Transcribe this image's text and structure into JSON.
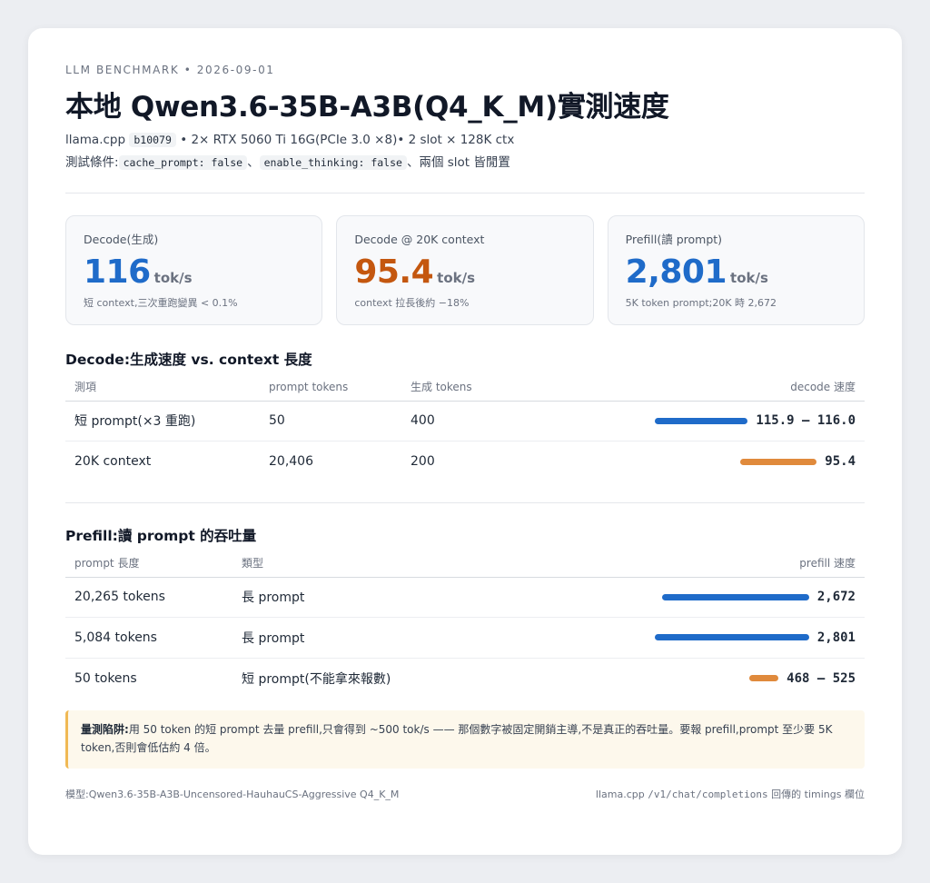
{
  "header": {
    "eyebrow": "LLM BENCHMARK • 2026-09-01",
    "title": "本地 Qwen3.6-35B-A3B(Q4_K_M)實測速度",
    "sub1": {
      "prefix": "llama.cpp",
      "build": "b10079",
      "rest": "• 2× RTX 5060 Ti 16G(PCIe 3.0 ×8)• 2 slot × 128K ctx"
    },
    "sub2": {
      "prefix": "測試條件:",
      "code1": "cache_prompt: false",
      "sep": "、",
      "code2": "enable_thinking: false",
      "suffix": "、兩個 slot 皆閒置"
    }
  },
  "stats": [
    {
      "label": "Decode(生成)",
      "value": "116",
      "unit": "tok/s",
      "note": "短 context,三次重跑變異 < 0.1%",
      "color": "#1f6bc9"
    },
    {
      "label": "Decode @ 20K context",
      "value": "95.4",
      "unit": "tok/s",
      "note": "context 拉長後約 −18%",
      "color": "#c4570f"
    },
    {
      "label": "Prefill(讀 prompt)",
      "value": "2,801",
      "unit": "tok/s",
      "note": "5K token prompt;20K 時 2,672",
      "color": "#1f6bc9"
    }
  ],
  "decode_section": {
    "title": "Decode:生成速度 vs. context 長度",
    "columns": [
      "測項",
      "prompt tokens",
      "生成 tokens",
      "decode 速度"
    ],
    "rows": [
      {
        "name": "短 prompt(×3 重跑)",
        "prompt": "50",
        "gen": "400",
        "speed": "115.9 – 116.0",
        "value": 116.0,
        "color": "#1f6bc9"
      },
      {
        "name": "20K context",
        "prompt": "20,406",
        "gen": "200",
        "speed": "95.4",
        "value": 95.4,
        "color": "#e08a3c"
      }
    ]
  },
  "prefill_section": {
    "title": "Prefill:讀 prompt 的吞吐量",
    "columns": [
      "prompt 長度",
      "類型",
      "prefill 速度"
    ],
    "rows": [
      {
        "len": "20,265 tokens",
        "type": "長 prompt",
        "speed": "2,672",
        "value": 2672,
        "color": "#1f6bc9"
      },
      {
        "len": "5,084 tokens",
        "type": "長 prompt",
        "speed": "2,801",
        "value": 2801,
        "color": "#1f6bc9"
      },
      {
        "len": "50 tokens",
        "type": "短 prompt(不能拿來報數)",
        "speed": "468 – 525",
        "value": 525,
        "color": "#e08a3c"
      }
    ]
  },
  "callout": {
    "label": "量測陷阱:",
    "text": "用 50 token 的短 prompt 去量 prefill,只會得到 ~500 tok/s —— 那個數字被固定開銷主導,不是真正的吞吐量。要報 prefill,prompt 至少要 5K token,否則會低估約 4 倍。"
  },
  "footer": {
    "left": "模型:Qwen3.6-35B-A3B-Uncensored-HauhauCS-Aggressive Q4_K_M",
    "right_prefix": "llama.cpp",
    "right_code": "/v1/chat/completions",
    "right_suffix": "回傳的 timings 欄位"
  }
}
